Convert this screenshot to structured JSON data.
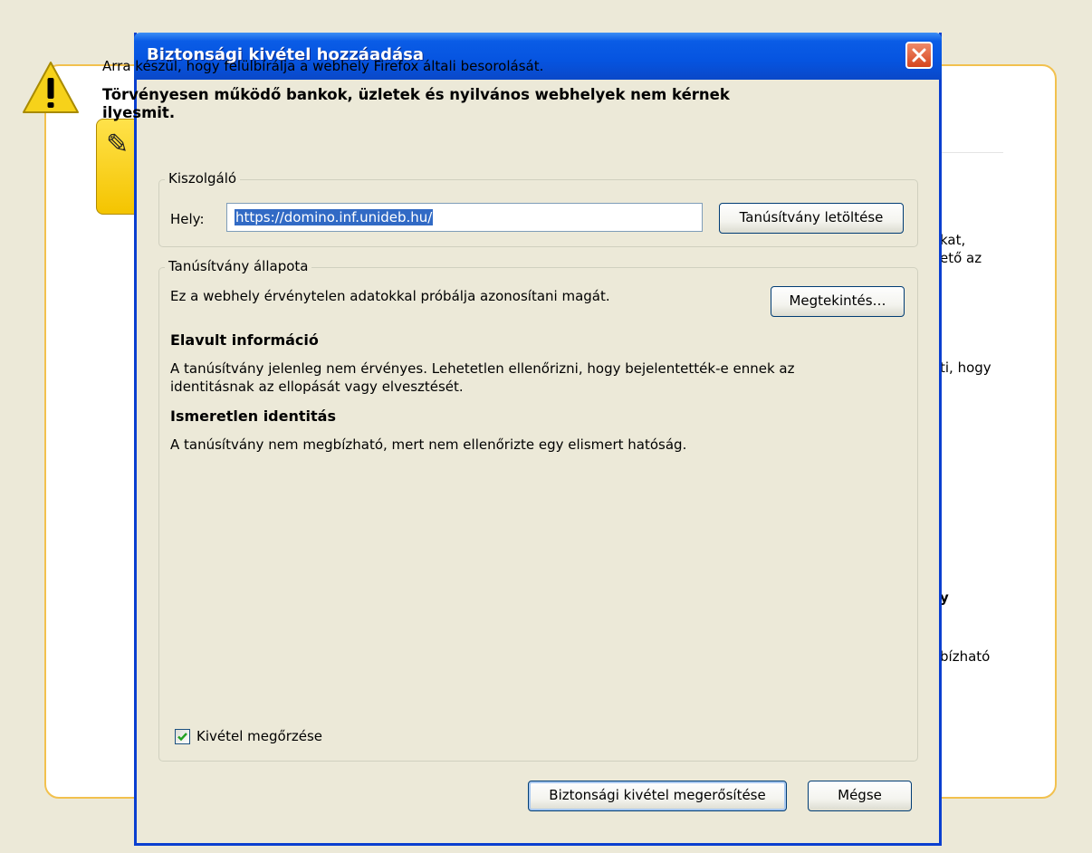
{
  "background_page": {
    "text_fragments": [
      "kat,",
      "ető az",
      "ti, hogy",
      "y",
      "bízható"
    ]
  },
  "dialog": {
    "title": "Biztonsági kivétel hozzáadása",
    "warning_line1": "Arra készül, hogy felülbírálja a webhely Firefox általi besorolását.",
    "warning_line2": "Törvényesen működő bankok, üzletek és nyilvános webhelyek nem kérnek ilyesmit.",
    "server": {
      "legend": "Kiszolgáló",
      "location_label": "Hely:",
      "url": "https://domino.inf.unideb.hu/",
      "download_button": "Tanúsítvány letöltése"
    },
    "certificate": {
      "legend": "Tanúsítvány állapota",
      "summary": "Ez a webhely érvénytelen adatokkal próbálja azonosítani magát.",
      "view_button": "Megtekintés…",
      "outdated_title": "Elavult információ",
      "outdated_line1": "A tanúsítvány jelenleg nem érvényes. Lehetetlen ellenőrizni, hogy bejelentették-e ennek az",
      "outdated_line2": "identitásnak az ellopását vagy elvesztését.",
      "unknown_title": "Ismeretlen identitás",
      "unknown_text": "A tanúsítvány nem megbízható, mert nem ellenőrizte egy elismert hatóság."
    },
    "keep_exception_label": "Kivétel megőrzése",
    "keep_exception_checked": true,
    "confirm_button": "Biztonsági kivétel megerősítése",
    "cancel_button": "Mégse"
  },
  "colors": {
    "titlebar": "#0654e0",
    "selection": "#316ac5",
    "card_border": "#f2c14e"
  }
}
